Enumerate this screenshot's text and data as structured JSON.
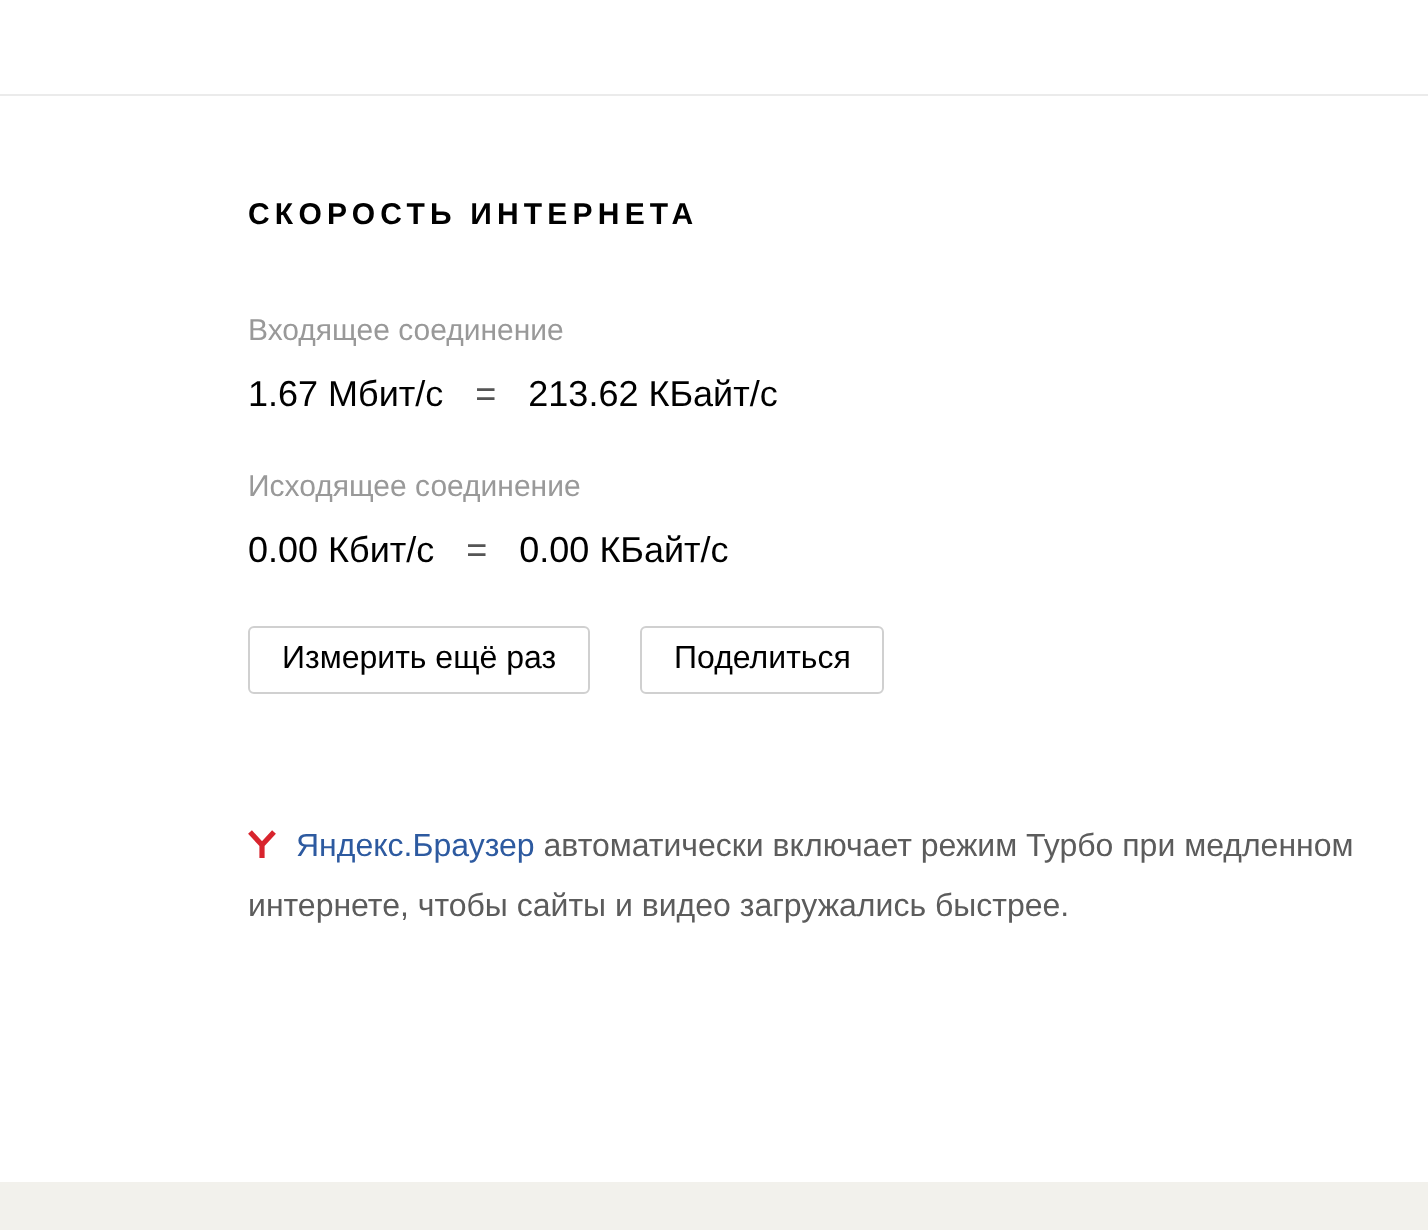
{
  "title": "СКОРОСТЬ ИНТЕРНЕТА",
  "connections": [
    {
      "label": "Входящее соединение",
      "bits": "1.67 Мбит/с",
      "equals": "=",
      "bytes": "213.62 КБайт/с"
    },
    {
      "label": "Исходящее соединение",
      "bits": "0.00 Кбит/с",
      "equals": "=",
      "bytes": "0.00 КБайт/с"
    }
  ],
  "buttons": [
    "Измерить ещё раз",
    "Поделиться"
  ],
  "note": {
    "link": "Яндекс.Браузер",
    "text": "автоматически включает режим Турбо при медленном интернете, чтобы сайты и видео загружались быстрее."
  }
}
